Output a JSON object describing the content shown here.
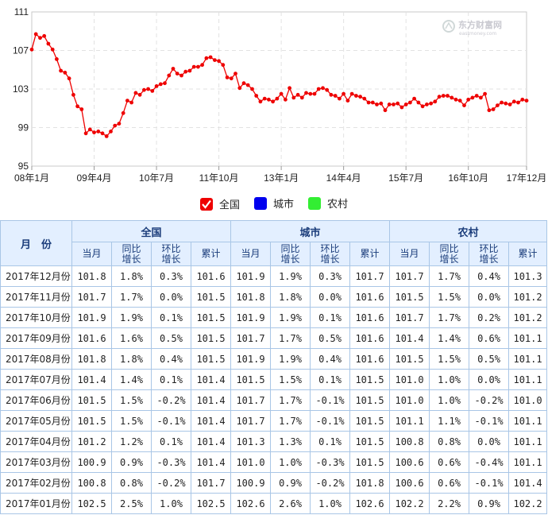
{
  "logo": {
    "name": "东方财富网",
    "domain": "eastmoney.com"
  },
  "chart_data": {
    "type": "line",
    "title": "",
    "xlabel": "",
    "ylabel": "",
    "ylim": [
      95,
      111
    ],
    "yticks": [
      95,
      99,
      103,
      107,
      111
    ],
    "xtick_labels": [
      "08年1月",
      "09年4月",
      "10年7月",
      "11年10月",
      "13年1月",
      "14年4月",
      "15年7月",
      "16年10月",
      "17年12月"
    ],
    "xtick_index": [
      0,
      15,
      30,
      45,
      60,
      75,
      90,
      105,
      119
    ],
    "grid": true,
    "series": [
      {
        "name": "全国",
        "color": "#ee0000",
        "values": [
          107.1,
          108.7,
          108.3,
          108.5,
          107.7,
          107.1,
          106.1,
          104.9,
          104.7,
          104.1,
          102.4,
          101.2,
          100.9,
          98.4,
          98.8,
          98.5,
          98.6,
          98.4,
          98.1,
          98.6,
          99.2,
          99.4,
          100.5,
          101.8,
          101.6,
          102.6,
          102.4,
          102.9,
          103.0,
          102.8,
          103.3,
          103.5,
          103.6,
          104.4,
          105.1,
          104.6,
          104.4,
          104.8,
          104.9,
          105.3,
          105.3,
          105.5,
          106.2,
          106.3,
          106.0,
          105.9,
          105.5,
          104.2,
          104.1,
          104.6,
          103.1,
          103.6,
          103.4,
          103.0,
          102.3,
          101.7,
          102.0,
          101.9,
          101.7,
          102.0,
          102.5,
          101.9,
          103.1,
          102.1,
          102.4,
          102.1,
          102.6,
          102.5,
          102.5,
          103.0,
          103.1,
          102.9,
          102.4,
          102.3,
          102.0,
          102.5,
          101.8,
          102.5,
          102.3,
          102.2,
          102.0,
          101.6,
          101.6,
          101.4,
          101.5,
          100.8,
          101.4,
          101.4,
          101.5,
          101.1,
          101.4,
          101.6,
          102.0,
          101.6,
          101.2,
          101.4,
          101.5,
          101.7,
          102.2,
          102.3,
          102.3,
          102.1,
          101.9,
          101.8,
          101.3,
          101.9,
          102.1,
          102.3,
          102.1,
          102.5,
          100.8,
          100.9,
          101.3,
          101.6,
          101.5,
          101.4,
          101.7,
          101.6,
          101.9,
          101.8
        ]
      }
    ]
  },
  "legend": [
    {
      "label": "全国",
      "color": "#ee0000",
      "checked": true
    },
    {
      "label": "城市",
      "color": "#0000ee",
      "checked": false
    },
    {
      "label": "农村",
      "color": "#33ee33",
      "checked": false
    }
  ],
  "table": {
    "month_header": "月　份",
    "groups": [
      "全国",
      "城市",
      "农村"
    ],
    "subheaders": [
      "当月",
      "同比\n增长",
      "环比\n增长",
      "累计"
    ],
    "rows": [
      [
        "2017年12月份",
        "101.8",
        "1.8%",
        "0.3%",
        "101.6",
        "101.9",
        "1.9%",
        "0.3%",
        "101.7",
        "101.7",
        "1.7%",
        "0.4%",
        "101.3"
      ],
      [
        "2017年11月份",
        "101.7",
        "1.7%",
        "0.0%",
        "101.5",
        "101.8",
        "1.8%",
        "0.0%",
        "101.6",
        "101.5",
        "1.5%",
        "0.0%",
        "101.2"
      ],
      [
        "2017年10月份",
        "101.9",
        "1.9%",
        "0.1%",
        "101.5",
        "101.9",
        "1.9%",
        "0.1%",
        "101.6",
        "101.7",
        "1.7%",
        "0.2%",
        "101.2"
      ],
      [
        "2017年09月份",
        "101.6",
        "1.6%",
        "0.5%",
        "101.5",
        "101.7",
        "1.7%",
        "0.5%",
        "101.6",
        "101.4",
        "1.4%",
        "0.6%",
        "101.1"
      ],
      [
        "2017年08月份",
        "101.8",
        "1.8%",
        "0.4%",
        "101.5",
        "101.9",
        "1.9%",
        "0.4%",
        "101.6",
        "101.5",
        "1.5%",
        "0.5%",
        "101.1"
      ],
      [
        "2017年07月份",
        "101.4",
        "1.4%",
        "0.1%",
        "101.4",
        "101.5",
        "1.5%",
        "0.1%",
        "101.5",
        "101.0",
        "1.0%",
        "0.0%",
        "101.1"
      ],
      [
        "2017年06月份",
        "101.5",
        "1.5%",
        "-0.2%",
        "101.4",
        "101.7",
        "1.7%",
        "-0.1%",
        "101.5",
        "101.0",
        "1.0%",
        "-0.2%",
        "101.0"
      ],
      [
        "2017年05月份",
        "101.5",
        "1.5%",
        "-0.1%",
        "101.4",
        "101.7",
        "1.7%",
        "-0.1%",
        "101.5",
        "101.1",
        "1.1%",
        "-0.1%",
        "101.1"
      ],
      [
        "2017年04月份",
        "101.2",
        "1.2%",
        "0.1%",
        "101.4",
        "101.3",
        "1.3%",
        "0.1%",
        "101.5",
        "100.8",
        "0.8%",
        "0.0%",
        "101.1"
      ],
      [
        "2017年03月份",
        "100.9",
        "0.9%",
        "-0.3%",
        "101.4",
        "101.0",
        "1.0%",
        "-0.3%",
        "101.5",
        "100.6",
        "0.6%",
        "-0.4%",
        "101.1"
      ],
      [
        "2017年02月份",
        "100.8",
        "0.8%",
        "-0.2%",
        "101.7",
        "100.9",
        "0.9%",
        "-0.2%",
        "101.8",
        "100.6",
        "0.6%",
        "-0.1%",
        "101.4"
      ],
      [
        "2017年01月份",
        "102.5",
        "2.5%",
        "1.0%",
        "102.5",
        "102.6",
        "2.6%",
        "1.0%",
        "102.6",
        "102.2",
        "2.2%",
        "0.9%",
        "102.2"
      ]
    ]
  }
}
